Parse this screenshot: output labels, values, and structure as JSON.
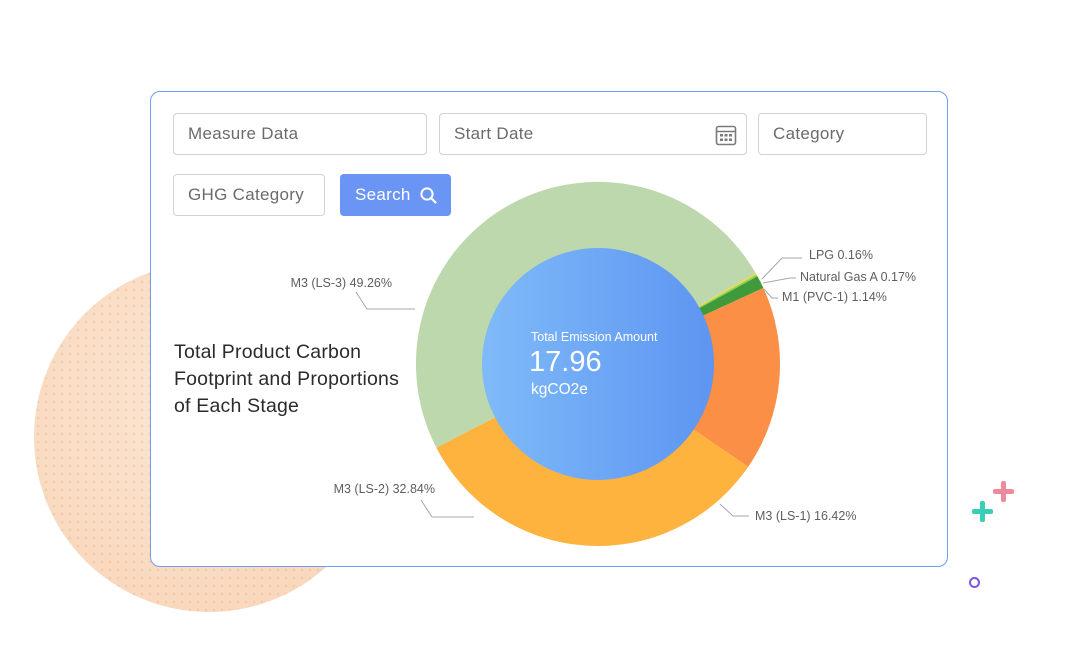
{
  "filters": {
    "measure_data": "Measure Data",
    "start_date": "Start Date",
    "category": "Category",
    "ghg_category": "GHG Category",
    "search_label": "Search"
  },
  "heading": "Total Product Carbon Footprint and Proportions of Each Stage",
  "center": {
    "label": "Total Emission Amount",
    "value": "17.96",
    "unit": "kgCO2e"
  },
  "colors": {
    "accent": "#6b95f4",
    "card_border": "#6f9df1"
  },
  "chart_data": {
    "type": "pie",
    "variant": "donut",
    "total": 17.96,
    "unit": "kgCO2e",
    "slices": [
      {
        "name": "LPG",
        "percent": 0.16,
        "label": "LPG  0.16%",
        "color": "#e8d84c"
      },
      {
        "name": "Natural Gas A",
        "percent": 0.17,
        "label": "Natural Gas A  0.17%",
        "color": "#8fd14f"
      },
      {
        "name": "M1 (PVC-1)",
        "percent": 1.14,
        "label": "M1 (PVC-1)  1.14%",
        "color": "#3f9a3a"
      },
      {
        "name": "M3 (LS-1)",
        "percent": 16.42,
        "label": "M3 (LS-1)  16.42%",
        "color": "#fb8f45"
      },
      {
        "name": "M3 (LS-2)",
        "percent": 32.84,
        "label": "M3 (LS-2)  32.84%",
        "color": "#feb33f"
      },
      {
        "name": "M3 (LS-3)",
        "percent": 49.26,
        "label": "M3 (LS-3)  49.26%",
        "color": "#bdd8ac"
      }
    ]
  }
}
